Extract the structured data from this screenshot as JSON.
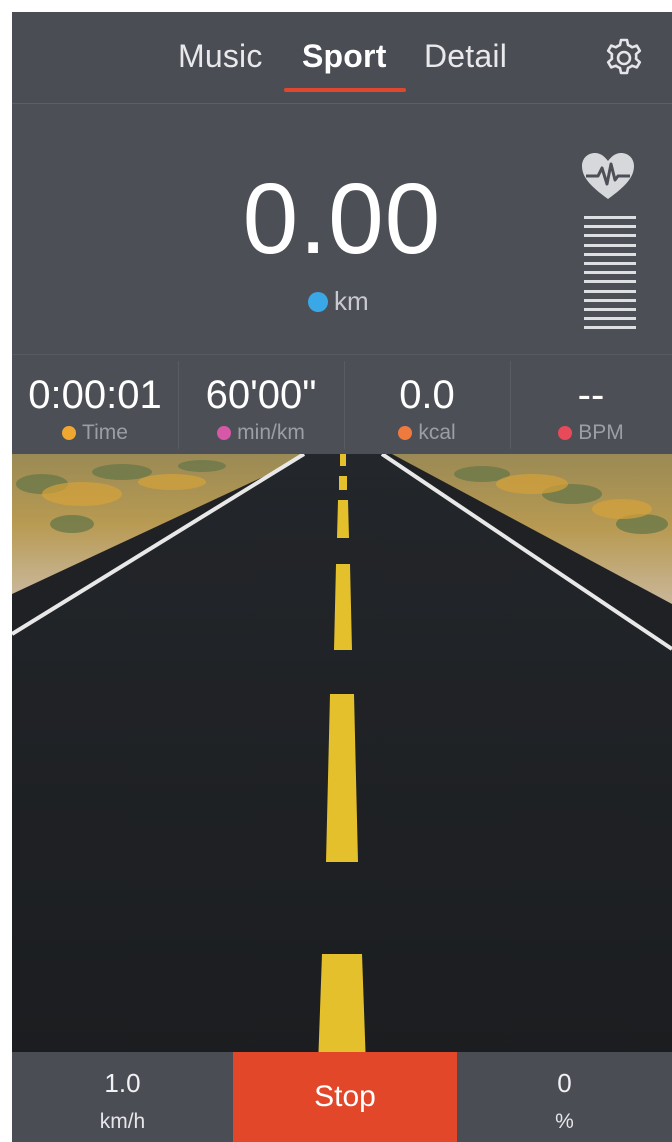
{
  "header": {
    "tabs": [
      {
        "label": "Music",
        "active": false
      },
      {
        "label": "Sport",
        "active": true
      },
      {
        "label": "Detail",
        "active": false
      }
    ],
    "settings_icon": "gear-icon"
  },
  "distance": {
    "value": "0.00",
    "unit": "km",
    "unit_icon_color": "#3aa8e6",
    "heart_icon": "heart-rate-icon"
  },
  "stats": [
    {
      "value": "0:00:01",
      "label": "Time",
      "icon_color": "#f0a732"
    },
    {
      "value": "60'00\"",
      "label": "min/km",
      "icon_color": "#d659a8"
    },
    {
      "value": "0.0",
      "label": "kcal",
      "icon_color": "#ef7a3e"
    },
    {
      "value": "--",
      "label": "BPM",
      "icon_color": "#e84a5a"
    }
  ],
  "controls": {
    "speed_value": "1.0",
    "speed_unit": "km/h",
    "stop_label": "Stop",
    "incline_value": "0",
    "incline_unit": "%"
  },
  "colors": {
    "accent": "#e3472a",
    "background": "#4b4d55"
  }
}
